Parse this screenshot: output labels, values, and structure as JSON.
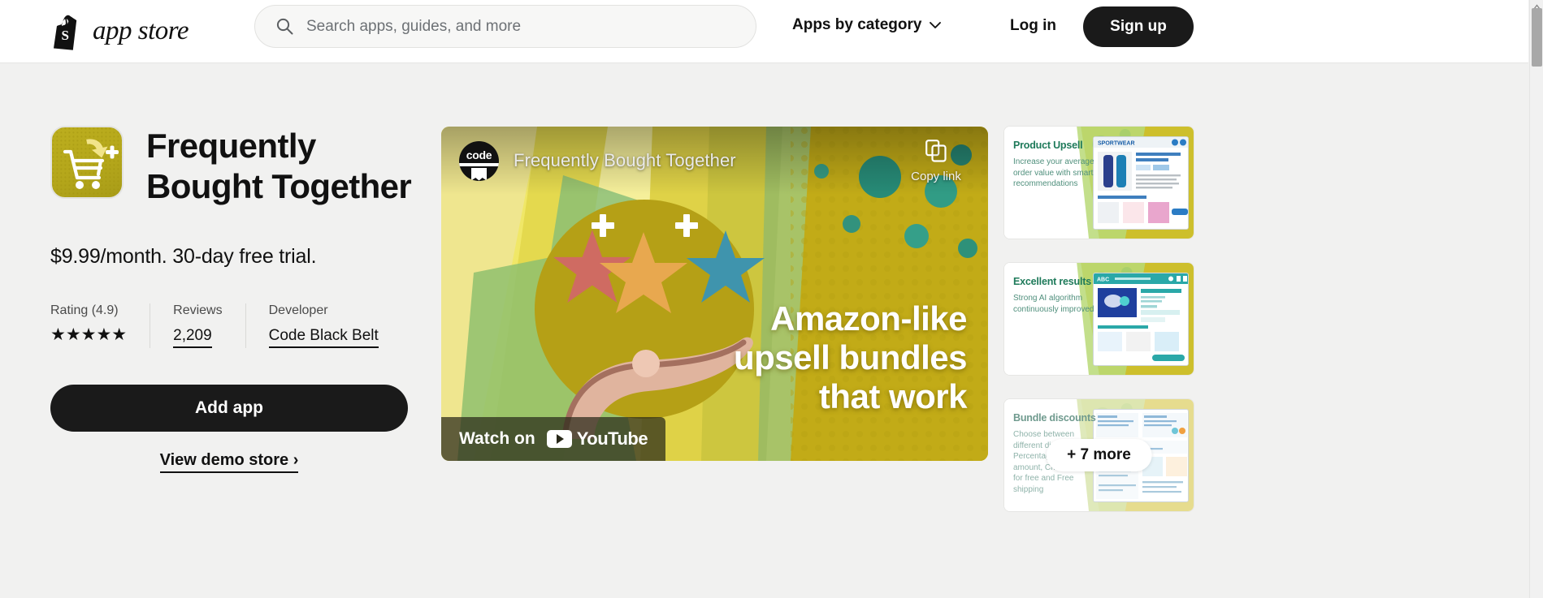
{
  "header": {
    "brand_word": "app store",
    "logo_icon": "shopify-bag-icon",
    "search": {
      "placeholder": "Search apps, guides, and more",
      "value": "",
      "icon": "search-icon"
    },
    "category_menu": "Apps by category",
    "category_chevron": "chevron-down-icon",
    "login": "Log in",
    "signup": "Sign up"
  },
  "app": {
    "icon_name": "shopping-cart-plus-icon",
    "title": "Frequently Bought Together",
    "price": "$9.99/month. 30-day free trial.",
    "meta": [
      {
        "label": "Rating (4.9)",
        "value": "★★★★★",
        "type": "stars"
      },
      {
        "label": "Reviews",
        "value": "2,209",
        "type": "link"
      },
      {
        "label": "Developer",
        "value": "Code Black Belt",
        "type": "link"
      }
    ],
    "add_button": "Add app",
    "demo_link": "View demo store  ›"
  },
  "video": {
    "channel_avatar_text": "code",
    "title": "Frequently Bought Together",
    "copy_link_label": "Copy link",
    "copy_link_icon": "copy-icon",
    "play_icon": "play-icon",
    "headline": "Amazon-like upsell bundles that work",
    "watch_on": "Watch on",
    "youtube_word": "YouTube"
  },
  "rail": {
    "thumbnails": [
      {
        "title": "Product Upsell",
        "body": "Increase your average order value with smart recommendations"
      },
      {
        "title": "Excellent results",
        "body": "Strong AI algorithm continuously improved"
      },
      {
        "title": "Bundle discounts",
        "body": "Choose between different discounts: Percentage, Fixed amount, Cheapest item for free and Free shipping"
      }
    ],
    "more_label": "+ 7 more"
  },
  "colors": {
    "brand_black": "#1a1a1a",
    "page_bg": "#f1f1f0",
    "app_icon_gold": "#b5a71b",
    "youtube_red": "#ff0000",
    "thumb_green": "#1e7a5a"
  }
}
